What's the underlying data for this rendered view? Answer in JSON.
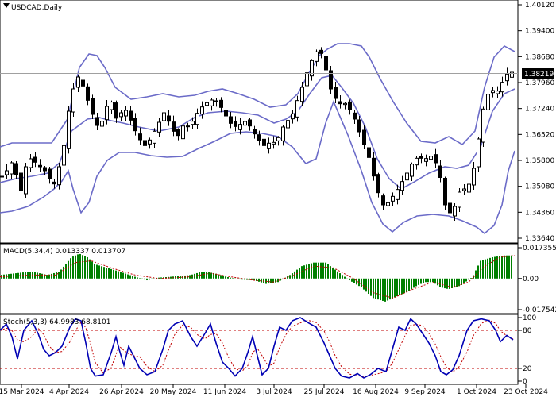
{
  "chart_data": [
    {
      "type": "candlestick",
      "title": "USDCAD,Daily",
      "current_price": "1.38219",
      "y_ticks": [
        "1.40120",
        "1.39400",
        "1.38680",
        "1.37960",
        "1.37240",
        "1.36520",
        "1.35800",
        "1.35080",
        "1.34360",
        "1.33640"
      ],
      "y_range": [
        1.3364,
        1.4012
      ],
      "overlay": "Bollinger Bands",
      "colors": {
        "bands": "#6b6bc8",
        "candles": "#000000",
        "price_line": "#a0a0a0"
      }
    },
    {
      "type": "bar",
      "title": "MACD(5,34,4) 0.013337 0.013707",
      "y_ticks": [
        "0.017355",
        "0.00",
        "-0.017542"
      ],
      "y_range": [
        -0.017542,
        0.017355
      ],
      "colors": {
        "histogram": "#008000",
        "signal": "#c00000"
      }
    },
    {
      "type": "line",
      "title": "Stoch(5,3,3) 64.9983 68.8101",
      "y_ticks": [
        "100",
        "80",
        "20",
        "0"
      ],
      "y_range": [
        0,
        100
      ],
      "levels": [
        20,
        80
      ],
      "colors": {
        "main": "#0000b4",
        "signal": "#c00000",
        "levels": "#c00000"
      }
    }
  ],
  "x_ticks": [
    "15 Mar 2024",
    "4 Apr 2024",
    "26 Apr 2024",
    "20 May 2024",
    "11 Jun 2024",
    "3 Jul 2024",
    "25 Jul 2024",
    "16 Aug 2024",
    "9 Sep 2024",
    "1 Oct 2024",
    "23 Oct 2024"
  ]
}
